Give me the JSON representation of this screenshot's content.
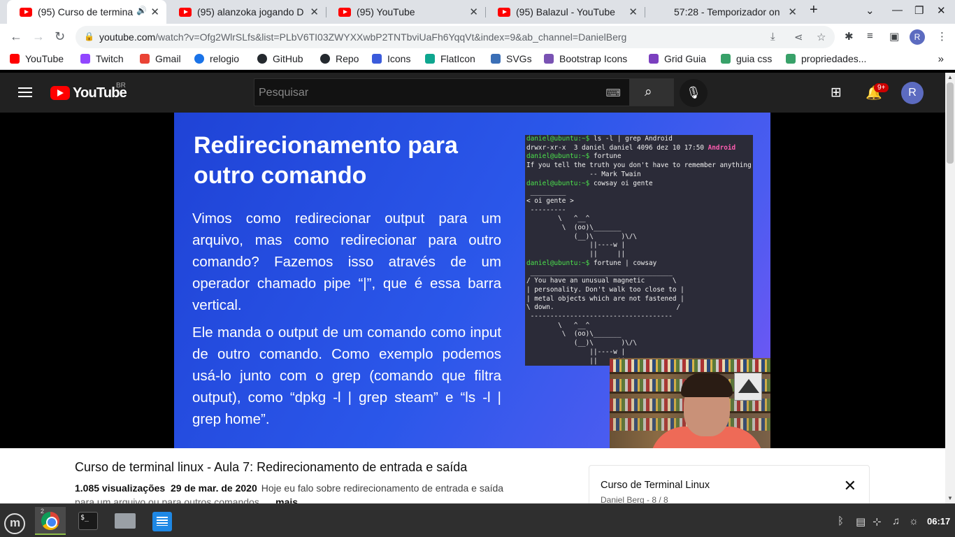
{
  "tabs": [
    {
      "title": "(95) Curso de termina",
      "icon": "youtube-favicon"
    },
    {
      "title": "(95) alanzoka jogando D",
      "icon": "youtube-favicon"
    },
    {
      "title": "(95) YouTube",
      "icon": "youtube-favicon"
    },
    {
      "title": "(95) Balazul - YouTube",
      "icon": "youtube-favicon"
    },
    {
      "title": "57:28 - Temporizador on",
      "icon": "timer-favicon"
    }
  ],
  "omnibox": {
    "host": "youtube.com",
    "path": "/watch?v=Ofg2WlrSLfs&list=PLbV6TI03ZWYXXwbP2TNTbviUaFh6YqqVt&index=9&ab_channel=DanielBerg"
  },
  "profile_initial": "R",
  "bookmarks": [
    {
      "label": "YouTube",
      "color": "#ff0000"
    },
    {
      "label": "Twitch",
      "color": "#9146ff"
    },
    {
      "label": "Gmail",
      "color": "#ea4335"
    },
    {
      "label": "relogio",
      "color": "#1a73e8"
    },
    {
      "label": "GitHub",
      "color": "#24292e"
    },
    {
      "label": "Repo",
      "color": "#24292e"
    },
    {
      "label": "Icons",
      "color": "#3b5bdb"
    },
    {
      "label": "FlatIcon",
      "color": "#0ea68f"
    },
    {
      "label": "SVGs",
      "color": "#3b6fb6"
    },
    {
      "label": "Bootstrap Icons",
      "color": "#7952b3"
    },
    {
      "label": "Grid Guia",
      "color": "#7b3fbf"
    },
    {
      "label": "guia css",
      "color": "#38a169"
    },
    {
      "label": "propriedades...",
      "color": "#38a169"
    }
  ],
  "youtube": {
    "logo_text": "YouTube",
    "country_code": "BR",
    "search_placeholder": "Pesquisar",
    "notifications_badge": "9+",
    "avatar_initial": "R"
  },
  "slide": {
    "title": "Redirecionamento para outro comando",
    "paragraph_1": "Vimos como redirecionar output para um arquivo, mas como redirecionar para outro comando? Fazemos isso através de um operador chamado pipe “|”, que é essa barra vertical.",
    "paragraph_2": "Ele manda o output de um comando como input de outro comando. Como exemplo podemos usá-lo junto com o grep (comando que filtra output), como “dpkg -l | grep steam” e “ls -l | grep home”."
  },
  "terminal_lines": [
    {
      "prompt": "daniel@ubuntu:~$ ",
      "text": "ls -l | grep Android"
    },
    {
      "prompt": "",
      "text": "drwxr-xr-x  3 daniel daniel 4096 dez 10 17:50 ",
      "hl": "Android"
    },
    {
      "prompt": "daniel@ubuntu:~$ ",
      "text": "fortune"
    },
    {
      "prompt": "",
      "text": "If you tell the truth you don't have to remember anything."
    },
    {
      "prompt": "",
      "text": "                -- Mark Twain"
    },
    {
      "prompt": "daniel@ubuntu:~$ ",
      "text": "cowsay oi gente"
    },
    {
      "prompt": "",
      "text": " _________"
    },
    {
      "prompt": "",
      "text": "< oi gente >"
    },
    {
      "prompt": "",
      "text": " ---------"
    },
    {
      "prompt": "",
      "text": "        \\   ^__^"
    },
    {
      "prompt": "",
      "text": "         \\  (oo)\\_______"
    },
    {
      "prompt": "",
      "text": "            (__)\\       )\\/\\"
    },
    {
      "prompt": "",
      "text": "                ||----w |"
    },
    {
      "prompt": "",
      "text": "                ||     ||"
    },
    {
      "prompt": "daniel@ubuntu:~$ ",
      "text": "fortune | cowsay"
    },
    {
      "prompt": "",
      "text": " ____________________________________"
    },
    {
      "prompt": "",
      "text": "/ You have an unusual magnetic       \\"
    },
    {
      "prompt": "",
      "text": "| personality. Don't walk too close to |"
    },
    {
      "prompt": "",
      "text": "| metal objects which are not fastened |"
    },
    {
      "prompt": "",
      "text": "\\ down.                               /"
    },
    {
      "prompt": "",
      "text": " ------------------------------------"
    },
    {
      "prompt": "",
      "text": "        \\   ^__^"
    },
    {
      "prompt": "",
      "text": "         \\  (oo)\\_______"
    },
    {
      "prompt": "",
      "text": "            (__)\\       )\\/\\"
    },
    {
      "prompt": "",
      "text": "                ||----w |"
    },
    {
      "prompt": "",
      "text": "                ||     ||"
    }
  ],
  "video_info": {
    "title": "Curso de terminal linux - Aula 7: Redirecionamento de entrada e saída",
    "views": "1.085 visualizações",
    "date": "29 de mar. de 2020",
    "description": "Hoje eu falo sobre redirecionamento de entrada e saída",
    "description_2": "para um arquivo ou para outros comandos",
    "more_label": "...mais"
  },
  "playlist": {
    "title": "Curso de Terminal Linux",
    "subtitle": "Daniel Berg - 8 / 8"
  },
  "taskbar": {
    "chrome_window_count": "2",
    "clock": "06:17"
  }
}
